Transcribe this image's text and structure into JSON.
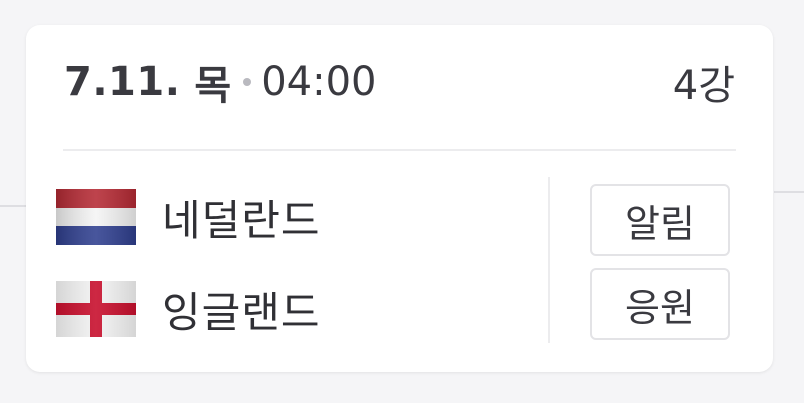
{
  "match": {
    "date": "7.11.",
    "day": "목",
    "time": "04:00",
    "round": "4강"
  },
  "teams": [
    {
      "name": "네덜란드",
      "flag_icon": "netherlands-flag-icon",
      "colors": [
        "#b52a34",
        "#ffffff",
        "#2f3f8f"
      ]
    },
    {
      "name": "잉글랜드",
      "flag_icon": "england-flag-icon",
      "colors": [
        "#ffffff",
        "#c8102e"
      ]
    }
  ],
  "buttons": {
    "alarm_label": "알림",
    "cheer_label": "응원"
  }
}
